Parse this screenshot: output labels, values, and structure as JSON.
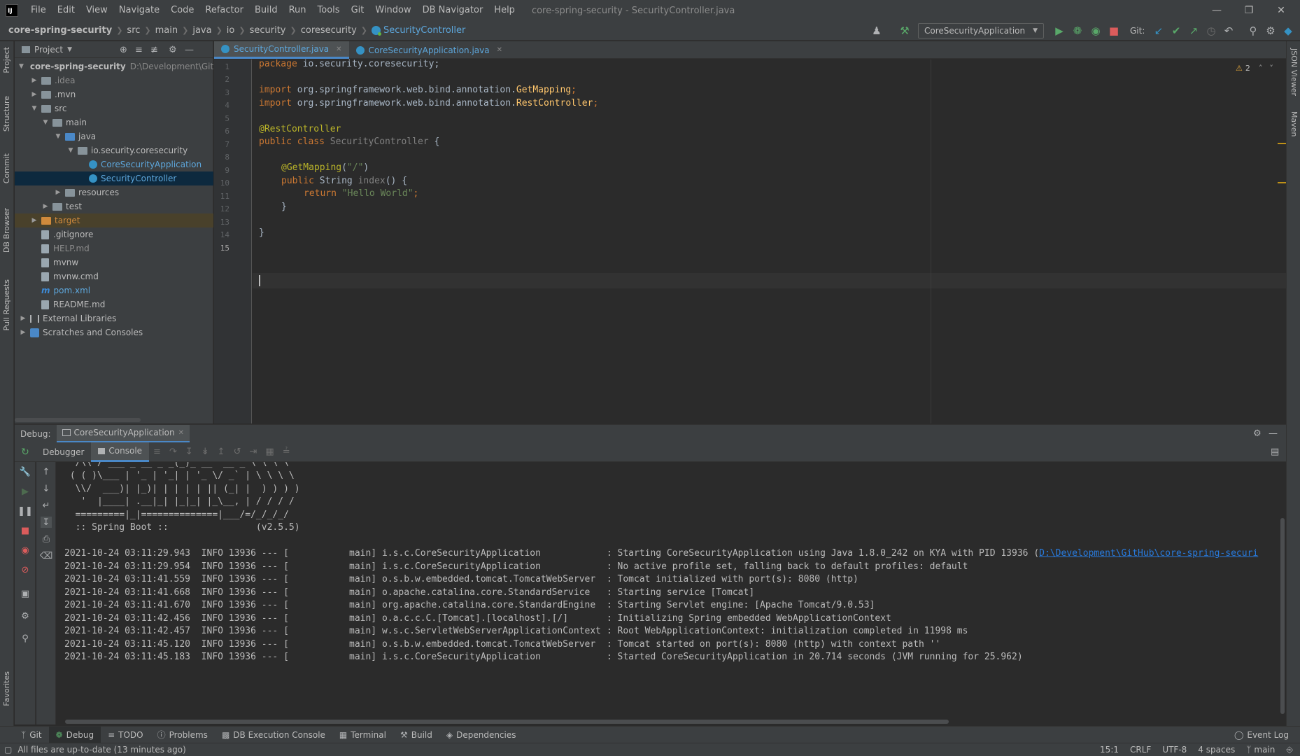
{
  "app": {
    "logo_text": "IJ",
    "window_title": "core-spring-security - SecurityController.java",
    "menu": [
      "File",
      "Edit",
      "View",
      "Navigate",
      "Code",
      "Refactor",
      "Build",
      "Run",
      "Tools",
      "Git",
      "Window",
      "DB Navigator",
      "Help"
    ]
  },
  "breadcrumb": [
    "core-spring-security",
    "src",
    "main",
    "java",
    "io",
    "security",
    "coresecurity",
    "SecurityController"
  ],
  "toolbar": {
    "run_config": "CoreSecurityApplication",
    "git_label": "Git:"
  },
  "left_tool_tabs": [
    "Project",
    "Structure",
    "Commit",
    "DB Browser",
    "Pull Requests",
    "Favorites"
  ],
  "right_tool_tabs": [
    "JSON Viewer",
    "Maven"
  ],
  "project_panel": {
    "title": "Project",
    "tree": [
      {
        "label": "core-spring-security",
        "extra": "D:\\Development\\Git",
        "kind": "root"
      },
      {
        "label": ".idea",
        "kind": "folder"
      },
      {
        "label": ".mvn",
        "kind": "folder"
      },
      {
        "label": "src",
        "kind": "folder"
      },
      {
        "label": "main",
        "kind": "folder"
      },
      {
        "label": "java",
        "kind": "folder"
      },
      {
        "label": "io.security.coresecurity",
        "kind": "package"
      },
      {
        "label": "CoreSecurityApplication",
        "kind": "class"
      },
      {
        "label": "SecurityController",
        "kind": "class"
      },
      {
        "label": "resources",
        "kind": "folder"
      },
      {
        "label": "test",
        "kind": "folder"
      },
      {
        "label": "target",
        "kind": "folder"
      },
      {
        "label": ".gitignore",
        "kind": "file"
      },
      {
        "label": "HELP.md",
        "kind": "file"
      },
      {
        "label": "mvnw",
        "kind": "file"
      },
      {
        "label": "mvnw.cmd",
        "kind": "file"
      },
      {
        "label": "pom.xml",
        "kind": "maven"
      },
      {
        "label": "README.md",
        "kind": "file"
      },
      {
        "label": "External Libraries",
        "kind": "libs"
      },
      {
        "label": "Scratches and Consoles",
        "kind": "scratch"
      }
    ]
  },
  "editor": {
    "tabs": [
      {
        "label": "SecurityController.java",
        "active": true
      },
      {
        "label": "CoreSecurityApplication.java",
        "active": false
      }
    ],
    "warning_count": "2",
    "line_numbers": [
      "1",
      "2",
      "3",
      "4",
      "5",
      "6",
      "7",
      "8",
      "9",
      "10",
      "11",
      "12",
      "13",
      "14",
      "15"
    ],
    "code": {
      "l1_kw": "package ",
      "l1_rest": "io.security.coresecurity;",
      "l3_kw": "import ",
      "l3_pkg": "org.springframework.web.bind.annotation.",
      "l3_cls": "GetMapping",
      "l3_end": ";",
      "l4_kw": "import ",
      "l4_pkg": "org.springframework.web.bind.annotation.",
      "l4_cls": "RestController",
      "l4_end": ";",
      "l6": "@RestController",
      "l7_kw": "public class ",
      "l7_name": "SecurityController",
      "l7_end": " {",
      "l9_an": "@GetMapping",
      "l9_open": "(",
      "l9_str": "\"/\"",
      "l9_close": ")",
      "l10_kw": "public ",
      "l10_type": "String ",
      "l10_fn": "index",
      "l10_end": "() {",
      "l11_kw": "return ",
      "l11_str": "\"Hello World\"",
      "l11_end": ";",
      "l12": "}",
      "l14": "}"
    }
  },
  "debug": {
    "label": "Debug:",
    "session": "CoreSecurityApplication",
    "subtabs": [
      "Debugger",
      "Console"
    ]
  },
  "console": {
    "banner": [
      "  /\\\\ / ___'_ __ _ _(_)_ __  __ _ \\ \\ \\ \\",
      " ( ( )\\___ | '_ | '_| | '_ \\/ _` | \\ \\ \\ \\",
      "  \\\\/  ___)| |_)| | | | | || (_| |  ) ) ) )",
      "   '  |____| .__|_| |_|_| |_\\__, | / / / /",
      "  =========|_|==============|___/=/_/_/_/",
      "  :: Spring Boot ::                (v2.5.5)"
    ],
    "log_lines": [
      "2021-10-24 03:11:29.943  INFO 13936 --- [           main] i.s.c.CoreSecurityApplication            : Starting CoreSecurityApplication using Java 1.8.0_242 on KYA with PID 13936 (",
      "2021-10-24 03:11:29.954  INFO 13936 --- [           main] i.s.c.CoreSecurityApplication            : No active profile set, falling back to default profiles: default",
      "2021-10-24 03:11:41.559  INFO 13936 --- [           main] o.s.b.w.embedded.tomcat.TomcatWebServer  : Tomcat initialized with port(s): 8080 (http)",
      "2021-10-24 03:11:41.668  INFO 13936 --- [           main] o.apache.catalina.core.StandardService   : Starting service [Tomcat]",
      "2021-10-24 03:11:41.670  INFO 13936 --- [           main] org.apache.catalina.core.StandardEngine  : Starting Servlet engine: [Apache Tomcat/9.0.53]",
      "2021-10-24 03:11:42.456  INFO 13936 --- [           main] o.a.c.c.C.[Tomcat].[localhost].[/]       : Initializing Spring embedded WebApplicationContext",
      "2021-10-24 03:11:42.457  INFO 13936 --- [           main] w.s.c.ServletWebServerApplicationContext : Root WebApplicationContext: initialization completed in 11998 ms",
      "2021-10-24 03:11:45.120  INFO 13936 --- [           main] o.s.b.w.embedded.tomcat.TomcatWebServer  : Tomcat started on port(s): 8080 (http) with context path ''",
      "2021-10-24 03:11:45.183  INFO 13936 --- [           main] i.s.c.CoreSecurityApplication            : Started CoreSecurityApplication in 20.714 seconds (JVM running for 25.962)"
    ],
    "path_link": "D:\\Development\\GitHub\\core-spring-securi"
  },
  "tool_windows": [
    "Git",
    "Debug",
    "TODO",
    "Problems",
    "DB Execution Console",
    "Terminal",
    "Build",
    "Dependencies"
  ],
  "event_log": "Event Log",
  "status": {
    "message": "All files are up-to-date (13 minutes ago)",
    "position": "15:1",
    "line_sep": "CRLF",
    "encoding": "UTF-8",
    "indent": "4 spaces",
    "branch": "main"
  },
  "colors": {
    "accent": "#4a88c7",
    "keyword": "#cc7832",
    "annotation": "#bbb529",
    "string": "#6a8759",
    "link": "#287bde",
    "run_green": "#59a869",
    "stop_red": "#db5c5c"
  }
}
